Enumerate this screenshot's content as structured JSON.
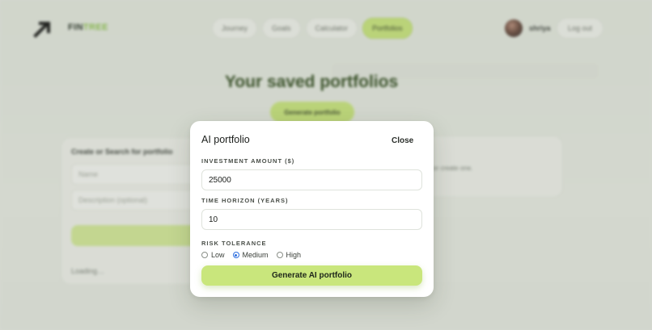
{
  "background": {
    "brand": {
      "part1": "FIN",
      "part2": "TREE"
    },
    "nav": [
      "Journey",
      "Goals",
      "Calculator",
      "Portfolios"
    ],
    "active_nav": "Portfolios",
    "user": {
      "name": "shriya"
    },
    "logout_label": "Log out",
    "page_title": "Your saved portfolios",
    "generate_label": "Generate portfolio",
    "create_card": {
      "title": "Create or Search for portfolio",
      "name_placeholder": "Name",
      "description_placeholder": "Description (optional)",
      "create_label": "Create",
      "loading_text": "Loading…"
    },
    "hint_text": "or create one."
  },
  "modal": {
    "title": "AI portfolio",
    "close_label": "Close",
    "investment_label": "INVESTMENT AMOUNT ($)",
    "investment_value": "25000",
    "horizon_label": "TIME HORIZON (YEARS)",
    "horizon_value": "10",
    "risk_label": "RISK TOLERANCE",
    "risk_options": [
      "Low",
      "Medium",
      "High"
    ],
    "risk_selected": "Medium",
    "submit_label": "Generate AI portfolio"
  },
  "colors": {
    "accent": "#c9e67c",
    "brand_green": "#8bc34a",
    "title_green": "#2f4a1e",
    "radio_blue": "#2f6fe0"
  }
}
